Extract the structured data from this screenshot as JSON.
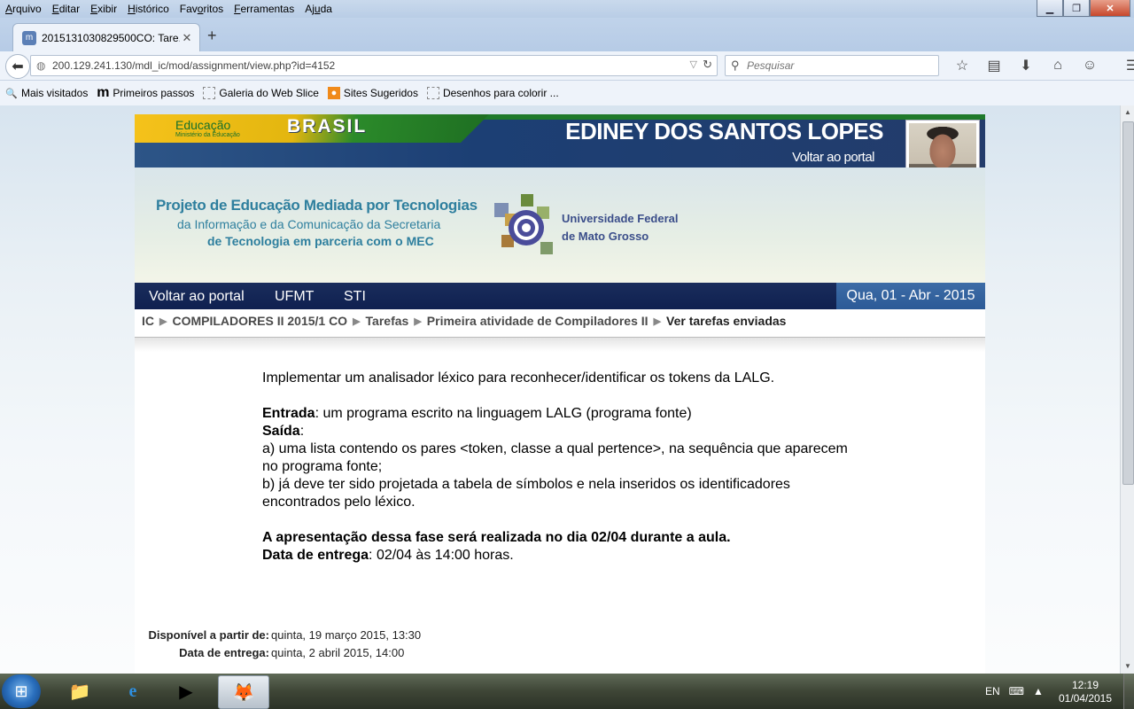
{
  "menubar": {
    "items": [
      {
        "pre": "",
        "u": "A",
        "post": "rquivo"
      },
      {
        "pre": "",
        "u": "E",
        "post": "ditar"
      },
      {
        "pre": "",
        "u": "E",
        "post": "xibir"
      },
      {
        "pre": "",
        "u": "H",
        "post": "istórico"
      },
      {
        "pre": "Fav",
        "u": "o",
        "post": "ritos"
      },
      {
        "pre": "",
        "u": "F",
        "post": "erramentas"
      },
      {
        "pre": "Aj",
        "u": "u",
        "post": "da"
      }
    ]
  },
  "tab": {
    "title": "2015131030829500CO: Tare...",
    "close": "✕"
  },
  "newtab": "+",
  "url": "200.129.241.130/mdl_ic/mod/assignment/view.php?id=4152",
  "search": {
    "placeholder": "Pesquisar"
  },
  "bookmarks": [
    "Mais visitados",
    "Primeiros passos",
    "Galeria do Web Slice",
    "Sites Sugeridos",
    "Desenhos para colorir ..."
  ],
  "header": {
    "edu": "Educação",
    "edu_sub": "Ministério da Educação",
    "brasil": "BRASIL",
    "username": "EDINEY DOS SANTOS LOPES",
    "voltar": "Voltar ao portal"
  },
  "project": {
    "line1": "Projeto de Educação Mediada por Tecnologias",
    "line2": "da Informação e da Comunicação da Secretaria",
    "line3": "de Tecnologia em parceria com o MEC",
    "ufmt1": "Universidade Federal",
    "ufmt2": "de Mato Grosso"
  },
  "nav": {
    "links": [
      "Voltar ao portal",
      "UFMT",
      "STI"
    ],
    "date": "Qua, 01 - Abr - 2015"
  },
  "breadcrumb": [
    "IC",
    "COMPILADORES II 2015/1 CO",
    "Tarefas",
    "Primeira atividade de Compiladores II",
    "Ver tarefas enviadas"
  ],
  "content": {
    "intro": "Implementar um analisador léxico para reconhecer/identificar os tokens da LALG.",
    "entrada_label": "Entrada",
    "entrada_text": ": um programa escrito na linguagem LALG (programa fonte)",
    "saida_label": "Saída",
    "saida_colon": ":",
    "a_line1": "a) uma lista contendo os pares <token, classe a qual pertence>, na sequência que aparecem",
    "a_line2": "no programa fonte;",
    "b_line1": "b) já deve ter sido projetada a tabela de símbolos e nela inseridos os identificadores",
    "b_line2": "encontrados pelo léxico.",
    "apresentacao": "A apresentação dessa fase será realizada no dia 02/04 durante a aula.",
    "data_label": "Data de entrega",
    "data_text": ": 02/04 às 14:00 horas."
  },
  "dates": {
    "disp_label": "Disponível a partir de:",
    "disp_value": "quinta, 19 março 2015, 13:30",
    "entrega_label": "Data de entrega:",
    "entrega_value": "quinta, 2 abril 2015, 14:00"
  },
  "taskbar": {
    "lang": "EN",
    "time": "12:19",
    "date": "01/04/2015"
  }
}
